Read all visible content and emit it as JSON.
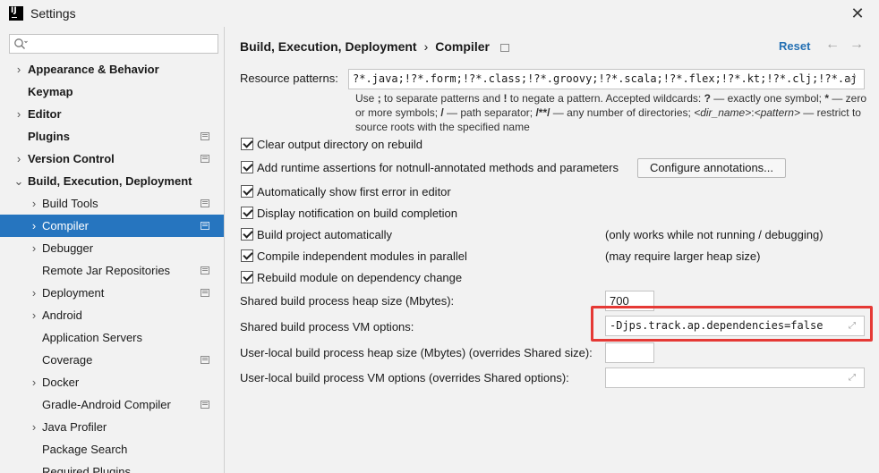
{
  "window": {
    "title": "Settings",
    "logo_text": "IJ"
  },
  "sidebar": {
    "search_placeholder": "",
    "items": [
      {
        "label": "Appearance & Behavior",
        "arrow": "›"
      },
      {
        "label": "Keymap",
        "arrow": ""
      },
      {
        "label": "Editor",
        "arrow": "›"
      },
      {
        "label": "Plugins",
        "arrow": ""
      },
      {
        "label": "Version Control",
        "arrow": "›"
      },
      {
        "label": "Build, Execution, Deployment",
        "arrow": "⌄"
      },
      {
        "label": "Build Tools",
        "arrow": "›"
      },
      {
        "label": "Compiler",
        "arrow": "›"
      },
      {
        "label": "Debugger",
        "arrow": "›"
      },
      {
        "label": "Remote Jar Repositories",
        "arrow": ""
      },
      {
        "label": "Deployment",
        "arrow": "›"
      },
      {
        "label": "Android",
        "arrow": "›"
      },
      {
        "label": "Application Servers",
        "arrow": ""
      },
      {
        "label": "Coverage",
        "arrow": ""
      },
      {
        "label": "Docker",
        "arrow": "›"
      },
      {
        "label": "Gradle-Android Compiler",
        "arrow": ""
      },
      {
        "label": "Java Profiler",
        "arrow": "›"
      },
      {
        "label": "Package Search",
        "arrow": ""
      },
      {
        "label": "Required Plugins",
        "arrow": ""
      }
    ]
  },
  "header": {
    "crumb_parent": "Build, Execution, Deployment",
    "crumb_sep": "›",
    "crumb_current": "Compiler",
    "reset_label": "Reset",
    "back_icon": "←",
    "forward_icon": "→"
  },
  "compiler": {
    "resource_patterns_label": "Resource patterns:",
    "resource_patterns_value": "?*.java;!?*.form;!?*.class;!?*.groovy;!?*.scala;!?*.flex;!?*.kt;!?*.clj;!?*.aj",
    "hint": {
      "p1": "Use ",
      "semi": ";",
      "p2": " to separate patterns and ",
      "bang": "!",
      "p3": " to negate a pattern. Accepted wildcards: ",
      "q": "?",
      "p4": " — exactly one symbol; ",
      "star": "*",
      "p5": " — zero or more symbols; ",
      "slash": "/",
      "p6": " — path separator; ",
      "dstar": "/**/",
      "p7": " — any number of directories; ",
      "dirname": "<dir_name>",
      "colon": ":",
      "pattern": "<pattern>",
      "p8": " — restrict to source roots with the specified name"
    },
    "checkboxes": [
      {
        "label": "Clear output directory on rebuild",
        "checked": true
      },
      {
        "label": "Add runtime assertions for notnull-annotated methods and parameters",
        "checked": true
      },
      {
        "label": "Automatically show first error in editor",
        "checked": true
      },
      {
        "label": "Display notification on build completion",
        "checked": true
      },
      {
        "label": "Build project automatically",
        "checked": true
      },
      {
        "label": "Compile independent modules in parallel",
        "checked": true
      },
      {
        "label": "Rebuild module on dependency change",
        "checked": true
      }
    ],
    "configure_annotations_label": "Configure annotations...",
    "note_auto_build": "(only works while not running / debugging)",
    "note_parallel": "(may require larger heap size)",
    "shared_heap_label": "Shared build process heap size (Mbytes):",
    "shared_heap_value": "700",
    "shared_vm_label": "Shared build process VM options:",
    "shared_vm_value": "-Djps.track.ap.dependencies=false",
    "local_heap_label": "User-local build process heap size (Mbytes) (overrides Shared size):",
    "local_heap_value": "",
    "local_vm_label": "User-local build process VM options (overrides Shared options):",
    "local_vm_value": ""
  }
}
